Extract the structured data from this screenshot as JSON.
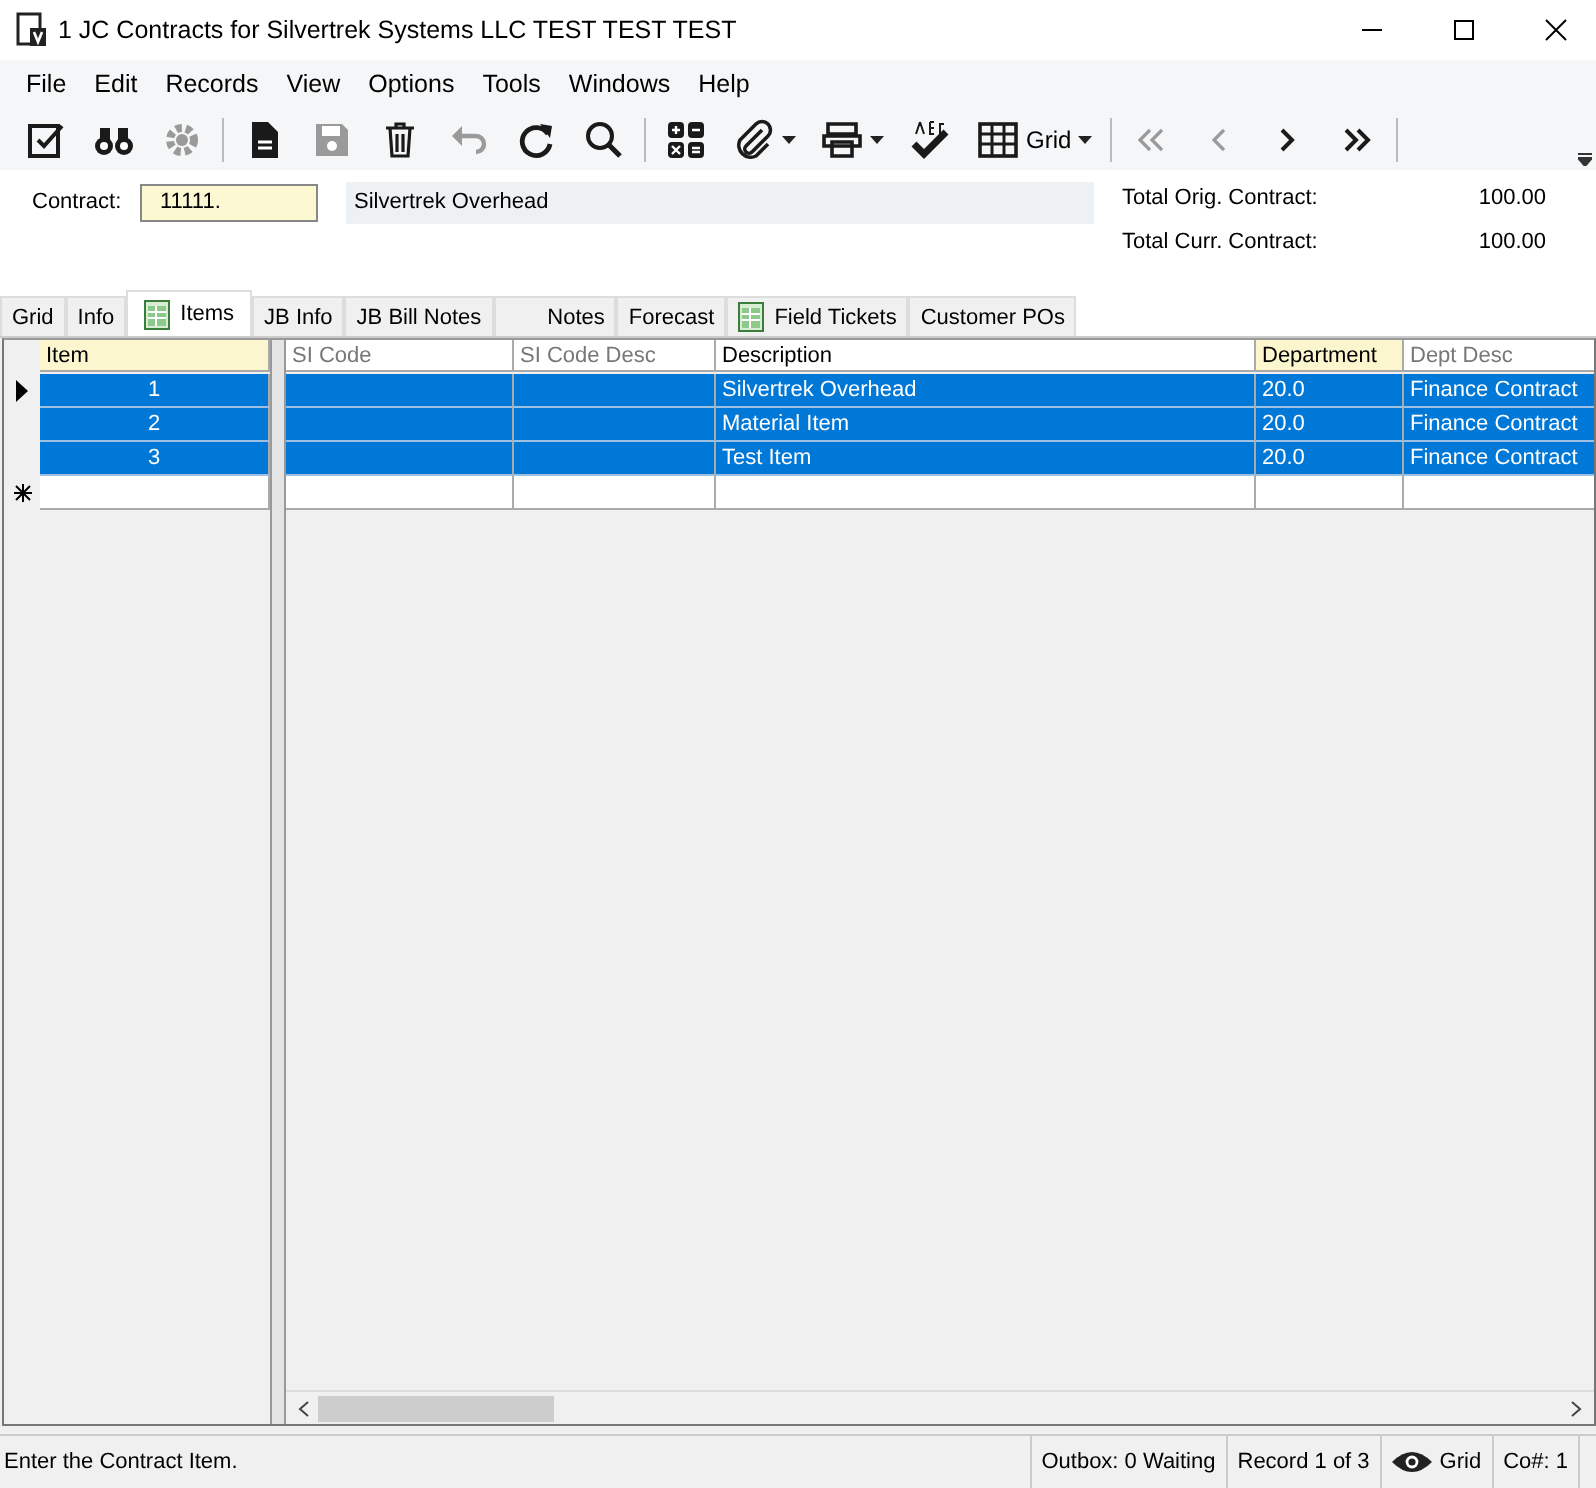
{
  "window": {
    "title": "1 JC Contracts for Silvertrek Systems LLC TEST TEST TEST"
  },
  "menu": [
    "File",
    "Edit",
    "Records",
    "View",
    "Options",
    "Tools",
    "Windows",
    "Help"
  ],
  "toolbar": [
    {
      "kind": "edit",
      "disabled": false
    },
    {
      "kind": "find",
      "disabled": false
    },
    {
      "kind": "gear",
      "disabled": true
    },
    {
      "kind": "sep"
    },
    {
      "kind": "new",
      "disabled": false
    },
    {
      "kind": "save",
      "disabled": true
    },
    {
      "kind": "delete",
      "disabled": false
    },
    {
      "kind": "undo",
      "disabled": true
    },
    {
      "kind": "refresh",
      "disabled": false
    },
    {
      "kind": "search",
      "disabled": false
    },
    {
      "kind": "sep"
    },
    {
      "kind": "calc",
      "disabled": false
    },
    {
      "kind": "attach",
      "disabled": false,
      "dropdown": true
    },
    {
      "kind": "print",
      "disabled": false,
      "dropdown": true
    },
    {
      "kind": "spell",
      "disabled": false
    },
    {
      "kind": "grid",
      "disabled": false,
      "dropdown": true,
      "label": "Grid"
    },
    {
      "kind": "sep"
    },
    {
      "kind": "first",
      "disabled": true
    },
    {
      "kind": "prev",
      "disabled": true
    },
    {
      "kind": "next",
      "disabled": false
    },
    {
      "kind": "last",
      "disabled": false
    },
    {
      "kind": "sep"
    }
  ],
  "header": {
    "contract_label": "Contract:",
    "contract": "11111.",
    "description": "Silvertrek Overhead",
    "totals": [
      {
        "label": "Total Orig. Contract:",
        "value": "100.00"
      },
      {
        "label": "Total Curr. Contract:",
        "value": "100.00"
      }
    ]
  },
  "tabs": [
    {
      "label": "Grid",
      "selected": false,
      "icon": false
    },
    {
      "label": "Info",
      "selected": false,
      "icon": false
    },
    {
      "label": "Items",
      "selected": true,
      "icon": true
    },
    {
      "label": "JB Info",
      "selected": false,
      "icon": false
    },
    {
      "label": "JB Bill Notes",
      "selected": false,
      "icon": false
    },
    {
      "label": "Notes",
      "selected": false,
      "icon": false
    },
    {
      "label": "Forecast",
      "selected": false,
      "icon": false
    },
    {
      "label": "Field Tickets",
      "selected": false,
      "icon": true
    },
    {
      "label": "Customer POs",
      "selected": false,
      "icon": false
    }
  ],
  "grid": {
    "columns": [
      {
        "label": "Item",
        "focused": true,
        "readonly": false
      },
      {
        "label": "SI Code",
        "focused": false,
        "readonly": true
      },
      {
        "label": "SI Code Desc",
        "focused": false,
        "readonly": true
      },
      {
        "label": "Description",
        "focused": false,
        "readonly": false
      },
      {
        "label": "Department",
        "focused": true,
        "readonly": false
      },
      {
        "label": "Dept Desc",
        "focused": false,
        "readonly": true
      }
    ],
    "rows": [
      {
        "current": true,
        "selected": true,
        "cells": [
          "1",
          "",
          "",
          "Silvertrek Overhead",
          "20.0",
          "Finance Contract"
        ]
      },
      {
        "current": false,
        "selected": true,
        "cells": [
          "2",
          "",
          "",
          "Material Item",
          "20.0",
          "Finance Contract"
        ]
      },
      {
        "current": false,
        "selected": true,
        "cells": [
          "3",
          "",
          "",
          "Test Item",
          "20.0",
          "Finance Contract"
        ]
      }
    ],
    "new_row": true
  },
  "status_bar": {
    "message": "Enter the Contract Item.",
    "outbox": "Outbox: 0 Waiting",
    "record": "Record 1 of 3",
    "view": "Grid",
    "company": "Co#: 1"
  }
}
